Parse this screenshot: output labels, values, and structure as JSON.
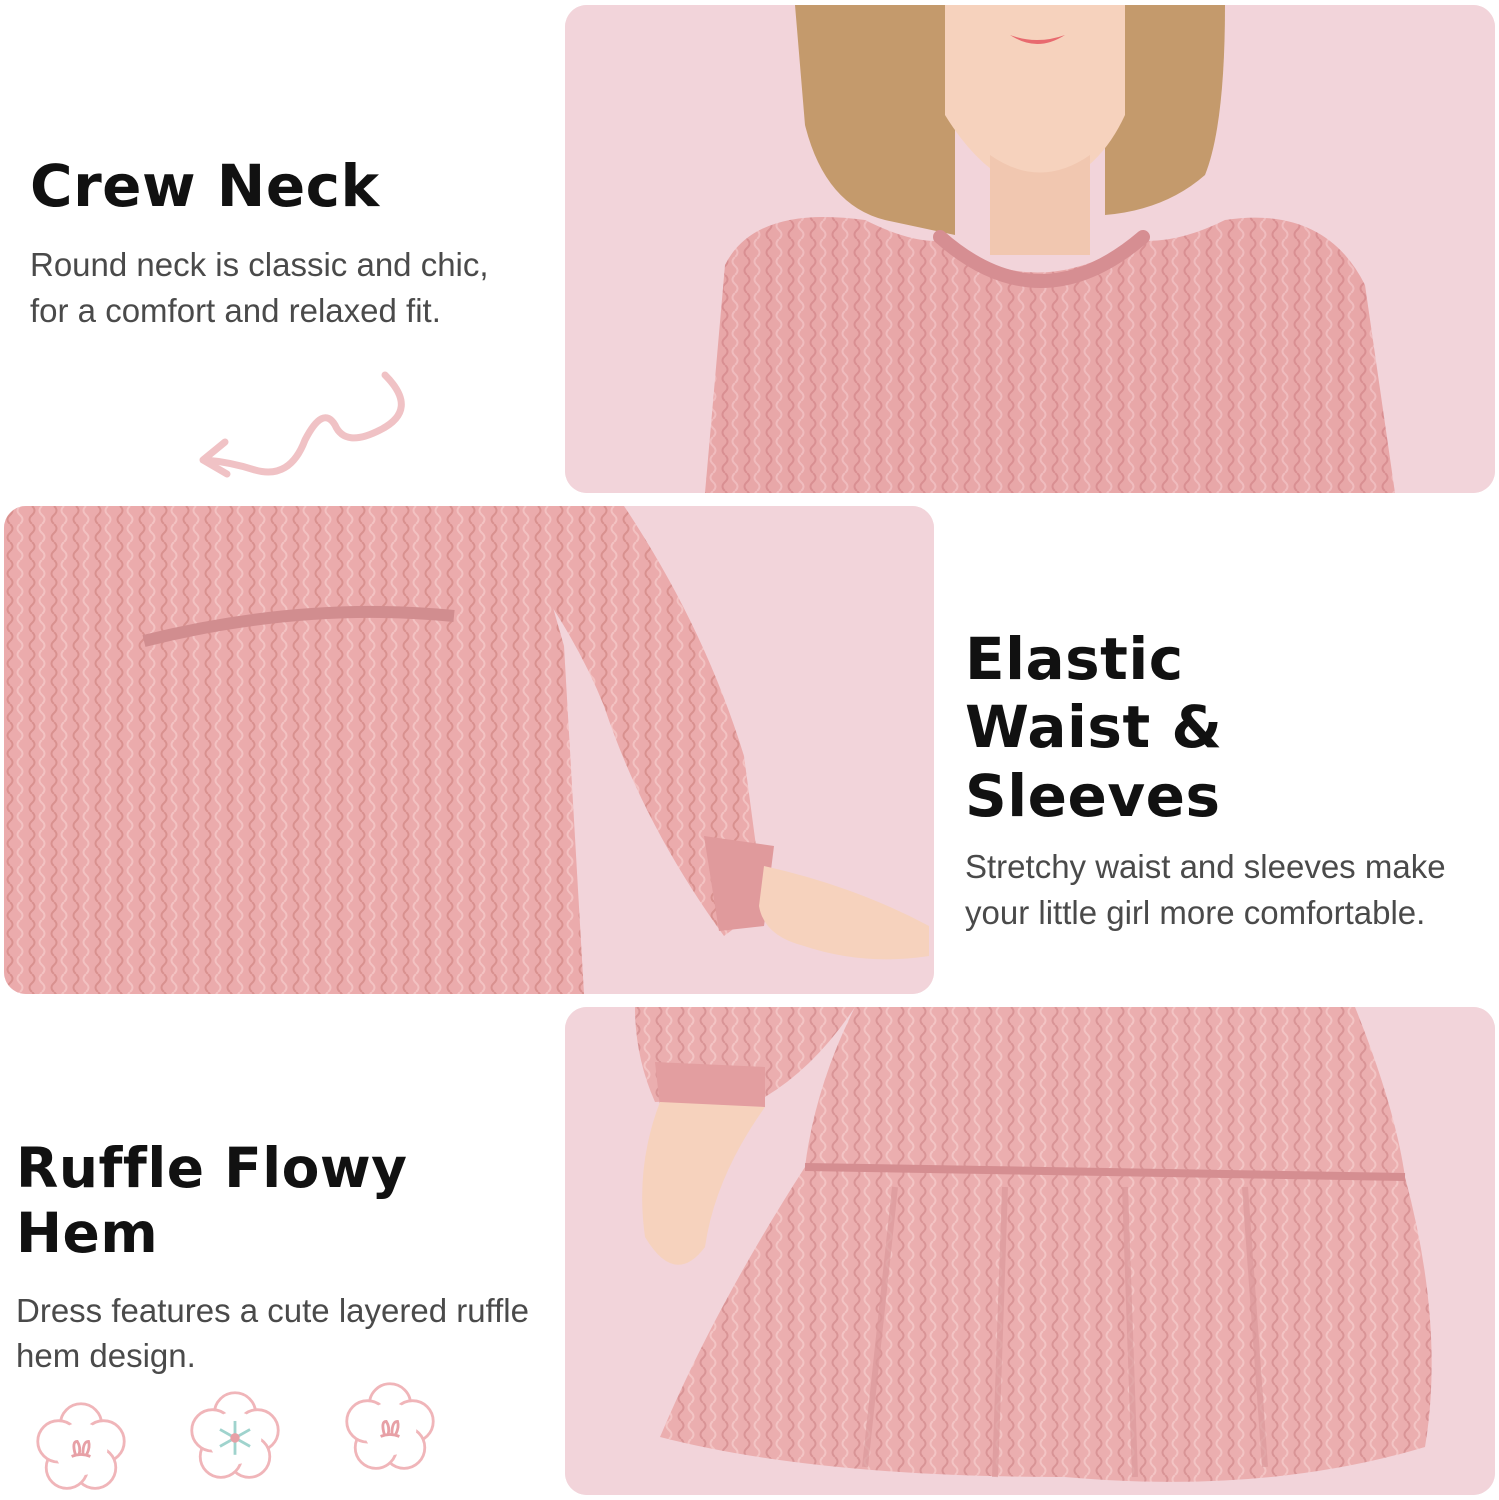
{
  "features": [
    {
      "title": "Crew Neck",
      "description_line1": "Round neck is classic and chic,",
      "description_line2": "for a comfort and relaxed fit."
    },
    {
      "title_line1": "Elastic",
      "title_line2": "Waist & Sleeves",
      "description_line1": "Stretchy waist and sleeves make",
      "description_line2": "your little girl more comfortable."
    },
    {
      "title": "Ruffle Flowy Hem",
      "description_line1": "Dress features a cute layered ruffle",
      "description_line2": "hem design."
    }
  ],
  "colors": {
    "panel_background": "#f2d4da",
    "dress_pink": "#e8a7a8",
    "accent_pink": "#f0c2c5",
    "title_text": "#111111",
    "body_text": "#4a4a4a"
  },
  "icons": [
    "wavy-arrow-icon",
    "flower-bunny-icon",
    "flower-snowflake-icon",
    "flower-bunny-icon"
  ]
}
